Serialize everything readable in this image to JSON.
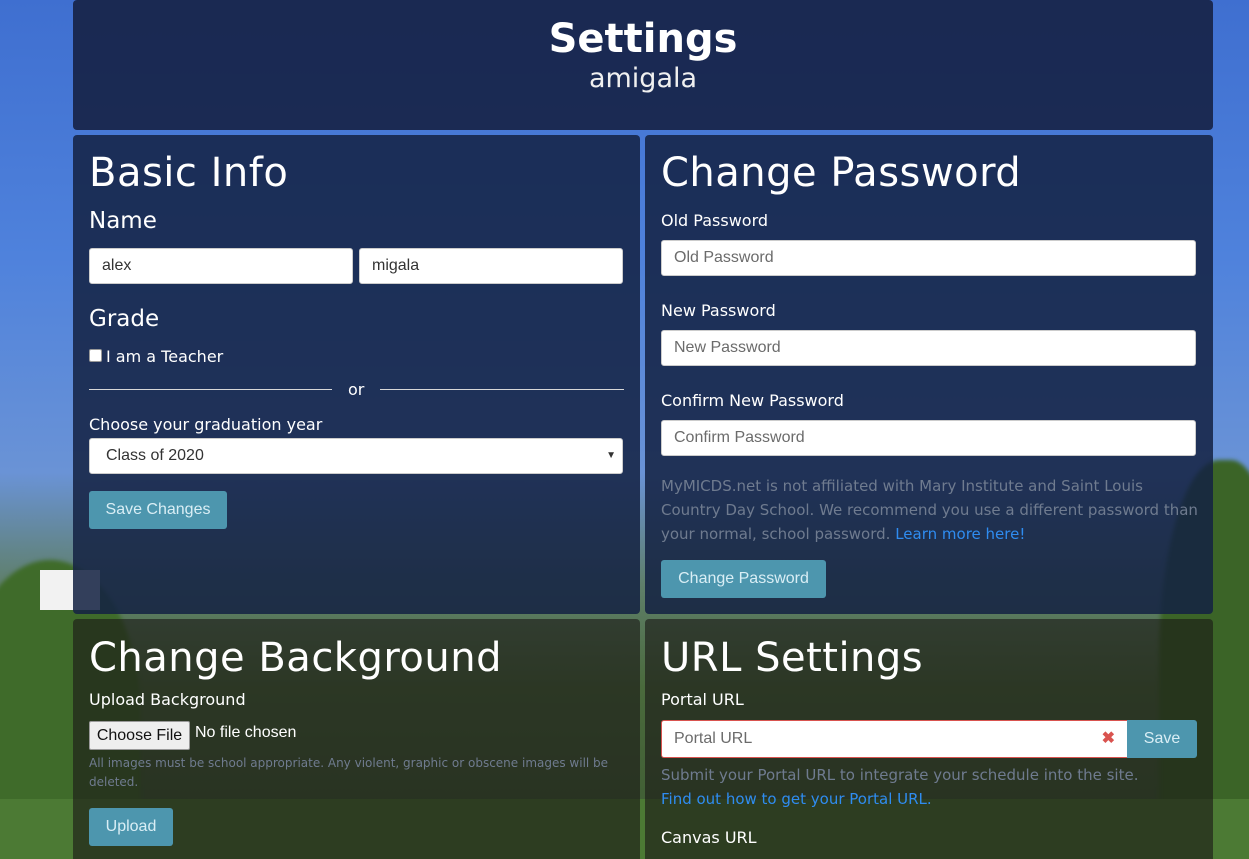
{
  "header": {
    "title": "Settings",
    "username": "amigala"
  },
  "basic_info": {
    "heading": "Basic Info",
    "name_label": "Name",
    "first_name": "alex",
    "last_name": "migala",
    "grade_label": "Grade",
    "teacher_label": "I am a Teacher",
    "teacher_checked": false,
    "or_text": "or",
    "grad_year_label": "Choose your graduation year",
    "grad_year_selected": "Class of 2020",
    "save_button": "Save Changes"
  },
  "change_password": {
    "heading": "Change Password",
    "old_label": "Old Password",
    "old_placeholder": "Old Password",
    "new_label": "New Password",
    "new_placeholder": "New Password",
    "confirm_label": "Confirm New Password",
    "confirm_placeholder": "Confirm Password",
    "disclaimer": "MyMICDS.net is not affiliated with Mary Institute and Saint Louis Country Day School. We recommend you use a different password than your normal, school password.",
    "learn_more_link": "Learn more here!",
    "button": "Change Password"
  },
  "change_background": {
    "heading": "Change Background",
    "upload_label": "Upload Background",
    "choose_file_button": "Choose File",
    "no_file_text": "No file chosen",
    "note": "All images must be school appropriate. Any violent, graphic or obscene images will be deleted.",
    "upload_button": "Upload"
  },
  "url_settings": {
    "heading": "URL Settings",
    "portal_label": "Portal URL",
    "portal_placeholder": "Portal URL",
    "clear_glyph": "✖",
    "save_button": "Save",
    "portal_help": "Submit your Portal URL to integrate your schedule into the site.",
    "portal_help_link": "Find out how to get your Portal URL.",
    "canvas_label": "Canvas URL"
  },
  "colors": {
    "panel_bg": "#14224a",
    "button_bg": "#4d96ae",
    "link": "#2f8cf0",
    "error_border": "#d9534f"
  }
}
